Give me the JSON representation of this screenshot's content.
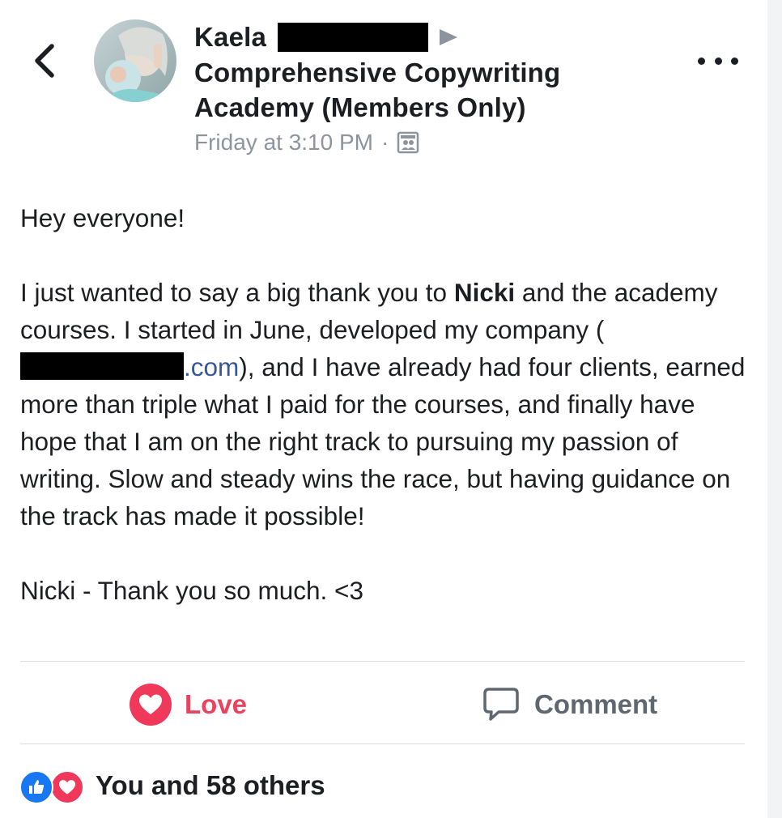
{
  "post": {
    "author_name": "Kaela",
    "group_line1": "Comprehensive Copywriting",
    "group_line2": "Academy (Members Only)",
    "timestamp": "Friday at 3:10 PM",
    "separator": "·",
    "privacy_icon": "group-members-icon",
    "body": {
      "greeting": "Hey everyone!",
      "para_start": "I just wanted to say a big thank you to ",
      "mention": "Nicki",
      "para_mid": " and the academy courses. I started in June, developed my company (",
      "link_text": ".com",
      "para_end": "), and I have already had four clients, earned more than triple what I paid for the courses, and finally have hope that I am on the right track to pursuing my passion of writing. Slow and steady wins the race, but having guidance on the track has made it possible!",
      "closing": "Nicki - Thank you so much. <3"
    }
  },
  "actions": {
    "love_label": "Love",
    "comment_label": "Comment"
  },
  "reactions": {
    "summary": "You and 58 others",
    "icons": [
      "like-icon",
      "heart-icon"
    ]
  },
  "colors": {
    "love": "#e9435f",
    "link": "#365899",
    "meta": "#8d949e",
    "like_blue": "#1877f2"
  }
}
